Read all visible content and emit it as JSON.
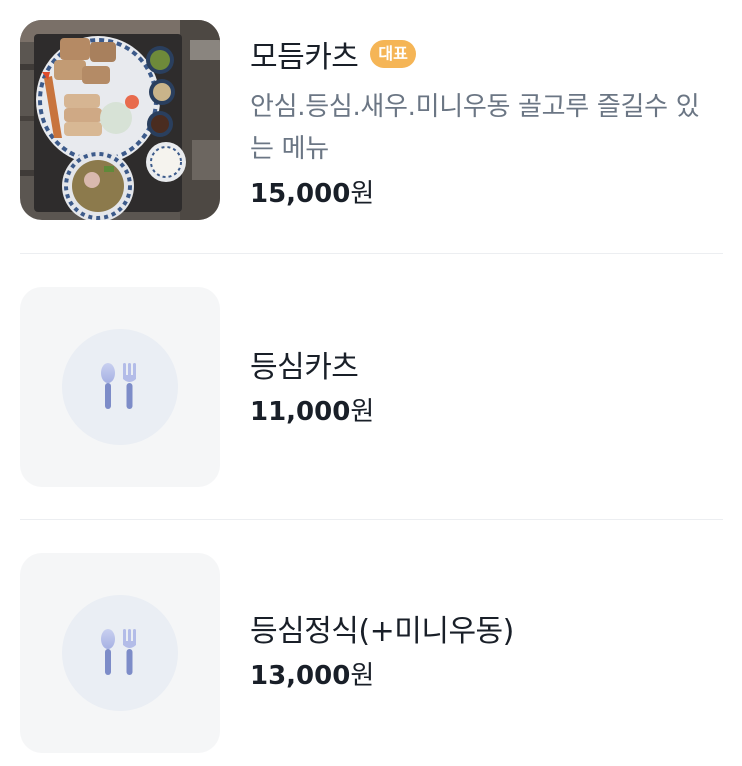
{
  "menu": {
    "items": [
      {
        "name": "모듬카츠",
        "badge": "대표",
        "description": "안심.등심.새우.미니우동 골고루 즐길수 있는 메뉴",
        "price": "15,000",
        "currency": "원",
        "image": "photo"
      },
      {
        "name": "등심카츠",
        "price": "11,000",
        "currency": "원",
        "image": "spoon-fork-icon"
      },
      {
        "name": "등심정식(+미니우동)",
        "price": "13,000",
        "currency": "원",
        "image": "spoon-fork-icon"
      }
    ]
  },
  "colors": {
    "badge": "#f5b556",
    "placeholder_bg": "#f5f6f7",
    "placeholder_circle": "#eaeef4",
    "icon": "#8d9bd3"
  }
}
